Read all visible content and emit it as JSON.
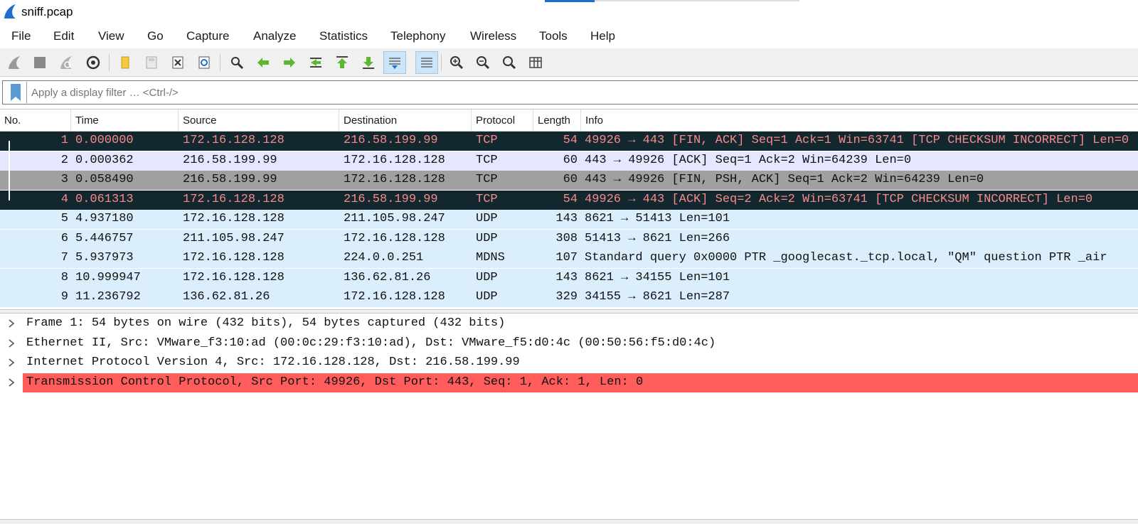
{
  "window": {
    "title": "sniff.pcap"
  },
  "menu": [
    "File",
    "Edit",
    "View",
    "Go",
    "Capture",
    "Analyze",
    "Statistics",
    "Telephony",
    "Wireless",
    "Tools",
    "Help"
  ],
  "toolbar": {
    "icons": [
      "shark-fin-start-icon",
      "stop-icon",
      "restart-icon",
      "capture-options-icon",
      "open-file-icon",
      "save-file-icon",
      "close-file-icon",
      "reload-icon",
      "find-icon",
      "go-back-icon",
      "go-forward-icon",
      "go-to-packet-icon",
      "first-packet-icon",
      "last-packet-icon",
      "autoscroll-icon",
      "colorize-icon",
      "zoom-in-icon",
      "zoom-out-icon",
      "normal-size-icon",
      "resize-columns-icon"
    ]
  },
  "filter": {
    "placeholder": "Apply a display filter … <Ctrl-/>"
  },
  "packet_list": {
    "columns": [
      "No.",
      "Time",
      "Source",
      "Destination",
      "Protocol",
      "Length",
      "Info"
    ],
    "rows": [
      {
        "no": "1",
        "time": "0.000000",
        "source": "172.16.128.128",
        "destination": "216.58.199.99",
        "protocol": "TCP",
        "length": "54",
        "info": "49926 → 443 [FIN, ACK] Seq=1 Ack=1 Win=63741 [TCP CHECKSUM INCORRECT] Len=0",
        "style": "sel-dark"
      },
      {
        "no": "2",
        "time": "0.000362",
        "source": "216.58.199.99",
        "destination": "172.16.128.128",
        "protocol": "TCP",
        "length": "60",
        "info": "443 → 49926 [ACK] Seq=1 Ack=2 Win=64239 Len=0",
        "style": "light-lav"
      },
      {
        "no": "3",
        "time": "0.058490",
        "source": "216.58.199.99",
        "destination": "172.16.128.128",
        "protocol": "TCP",
        "length": "60",
        "info": "443 → 49926 [FIN, PSH, ACK] Seq=1 Ack=2 Win=64239 Len=0",
        "style": "gray"
      },
      {
        "no": "4",
        "time": "0.061313",
        "source": "172.16.128.128",
        "destination": "216.58.199.99",
        "protocol": "TCP",
        "length": "54",
        "info": "49926 → 443 [ACK] Seq=2 Ack=2 Win=63741 [TCP CHECKSUM INCORRECT] Len=0",
        "style": "sel-dark"
      },
      {
        "no": "5",
        "time": "4.937180",
        "source": "172.16.128.128",
        "destination": "211.105.98.247",
        "protocol": "UDP",
        "length": "143",
        "info": "8621 → 51413 Len=101",
        "style": "light-blue"
      },
      {
        "no": "6",
        "time": "5.446757",
        "source": "211.105.98.247",
        "destination": "172.16.128.128",
        "protocol": "UDP",
        "length": "308",
        "info": "51413 → 8621 Len=266",
        "style": "light-blue"
      },
      {
        "no": "7",
        "time": "5.937973",
        "source": "172.16.128.128",
        "destination": "224.0.0.251",
        "protocol": "MDNS",
        "length": "107",
        "info": "Standard query 0x0000 PTR _googlecast._tcp.local, \"QM\" question PTR _air",
        "style": "light-blue"
      },
      {
        "no": "8",
        "time": "10.999947",
        "source": "172.16.128.128",
        "destination": "136.62.81.26",
        "protocol": "UDP",
        "length": "143",
        "info": "8621 → 34155 Len=101",
        "style": "light-blue"
      },
      {
        "no": "9",
        "time": "11.236792",
        "source": "136.62.81.26",
        "destination": "172.16.128.128",
        "protocol": "UDP",
        "length": "329",
        "info": "34155 → 8621 Len=287",
        "style": "light-blue"
      }
    ]
  },
  "details": [
    {
      "text": "Frame 1: 54 bytes on wire (432 bits), 54 bytes captured (432 bits)",
      "error": false
    },
    {
      "text": "Ethernet II, Src: VMware_f3:10:ad (00:0c:29:f3:10:ad), Dst: VMware_f5:d0:4c (00:50:56:f5:d0:4c)",
      "error": false
    },
    {
      "text": "Internet Protocol Version 4, Src: 172.16.128.128, Dst: 216.58.199.99",
      "error": false
    },
    {
      "text": "Transmission Control Protocol, Src Port: 49926, Dst Port: 443, Seq: 1, Ack: 1, Len: 0",
      "error": true
    }
  ],
  "colors": {
    "selected_bg": "#12272e",
    "selected_fg": "#f78b8b",
    "tcp_light": "#e7e6ff",
    "tcp_fin": "#a0a0a0",
    "udp": "#dbeefb",
    "error_bg": "#ff5c5c",
    "accent": "#1e6fd0"
  }
}
